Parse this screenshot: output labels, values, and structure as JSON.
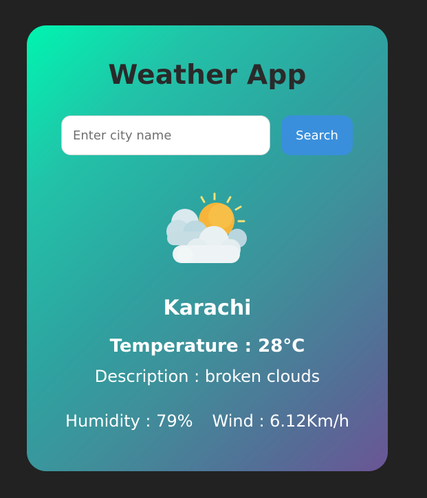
{
  "app": {
    "title": "Weather App"
  },
  "search": {
    "placeholder": "Enter city name",
    "value": "",
    "button_label": "Search"
  },
  "weather": {
    "icon": "partly-cloudy-sun-icon",
    "city": "Karachi",
    "temperature_text": "Temperature : 28°C",
    "description_text": "Description : broken clouds",
    "humidity_text": "Humidity : 79%",
    "wind_text": "Wind : 6.12Km/h"
  },
  "colors": {
    "page_background": "#222222",
    "gradient_start": "#00f5b0",
    "gradient_end": "#6b5595",
    "button_background": "#3a8fdc",
    "title_color": "#2a2a2a"
  }
}
